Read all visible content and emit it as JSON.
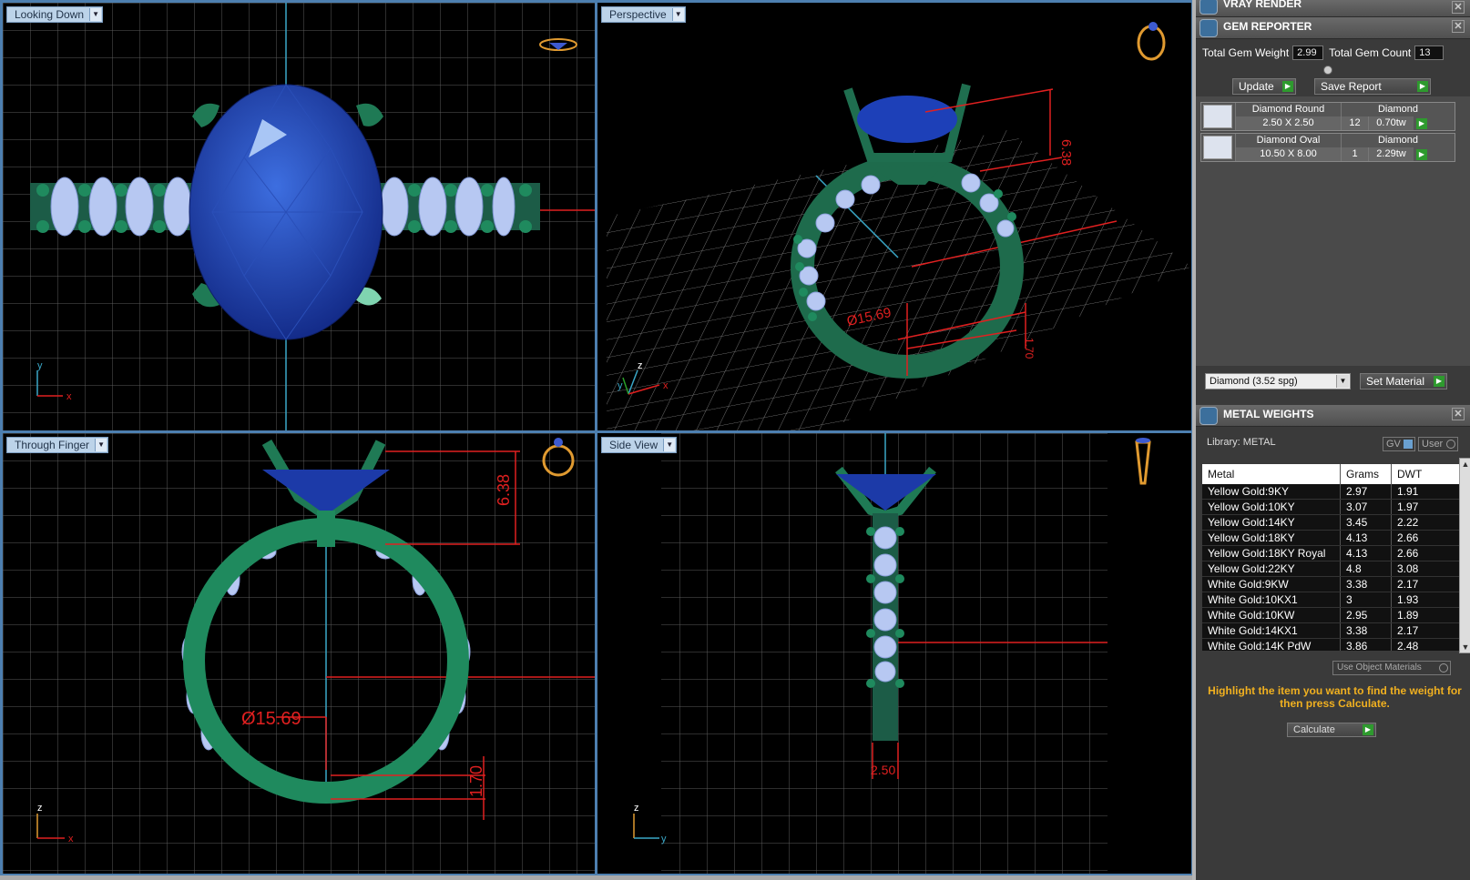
{
  "viewports": {
    "top_left": {
      "label": "Looking Down"
    },
    "top_right": {
      "label": "Perspective"
    },
    "bottom_left": {
      "label": "Through Finger"
    },
    "bottom_right": {
      "label": "Side View"
    }
  },
  "dimensions": {
    "height": "6.38",
    "diameter": "Ø15.69",
    "thickness": "1.70",
    "width": "2.50"
  },
  "axes": {
    "x": "x",
    "y": "y",
    "z": "z"
  },
  "vray": {
    "title": "VRAY RENDER"
  },
  "gem_reporter": {
    "title": "GEM REPORTER",
    "total_weight_label": "Total Gem Weight",
    "total_weight_value": "2.99",
    "total_count_label": "Total Gem Count",
    "total_count_value": "13",
    "update_label": "Update",
    "save_label": "Save Report",
    "gems": [
      {
        "name": "Diamond Round",
        "size": "2.50 X 2.50",
        "material": "Diamond",
        "count": "12",
        "weight": "0.70tw"
      },
      {
        "name": "Diamond Oval",
        "size": "10.50 X 8.00",
        "material": "Diamond",
        "count": "1",
        "weight": "2.29tw"
      }
    ],
    "material_select": "Diamond      (3.52 spg)",
    "set_material_label": "Set Material"
  },
  "metal_weights": {
    "title": "METAL WEIGHTS",
    "library_label": "Library: METAL",
    "gv_label": "GV",
    "user_label": "User",
    "columns": [
      "Metal",
      "Grams",
      "DWT"
    ],
    "rows": [
      [
        "Yellow Gold:9KY",
        "2.97",
        "1.91"
      ],
      [
        "Yellow Gold:10KY",
        "3.07",
        "1.97"
      ],
      [
        "Yellow Gold:14KY",
        "3.45",
        "2.22"
      ],
      [
        "Yellow Gold:18KY",
        "4.13",
        "2.66"
      ],
      [
        "Yellow Gold:18KY Royal",
        "4.13",
        "2.66"
      ],
      [
        "Yellow Gold:22KY",
        "4.8",
        "3.08"
      ],
      [
        "White Gold:9KW",
        "3.38",
        "2.17"
      ],
      [
        "White Gold:10KX1",
        "3",
        "1.93"
      ],
      [
        "White Gold:10KW",
        "2.95",
        "1.89"
      ],
      [
        "White Gold:14KX1",
        "3.38",
        "2.17"
      ],
      [
        "White Gold:14K PdW",
        "3.86",
        "2.48"
      ]
    ],
    "use_object_label": "Use Object Materials",
    "hint": "Highlight the item you want to find the weight for then press Calculate.",
    "calculate_label": "Calculate"
  }
}
